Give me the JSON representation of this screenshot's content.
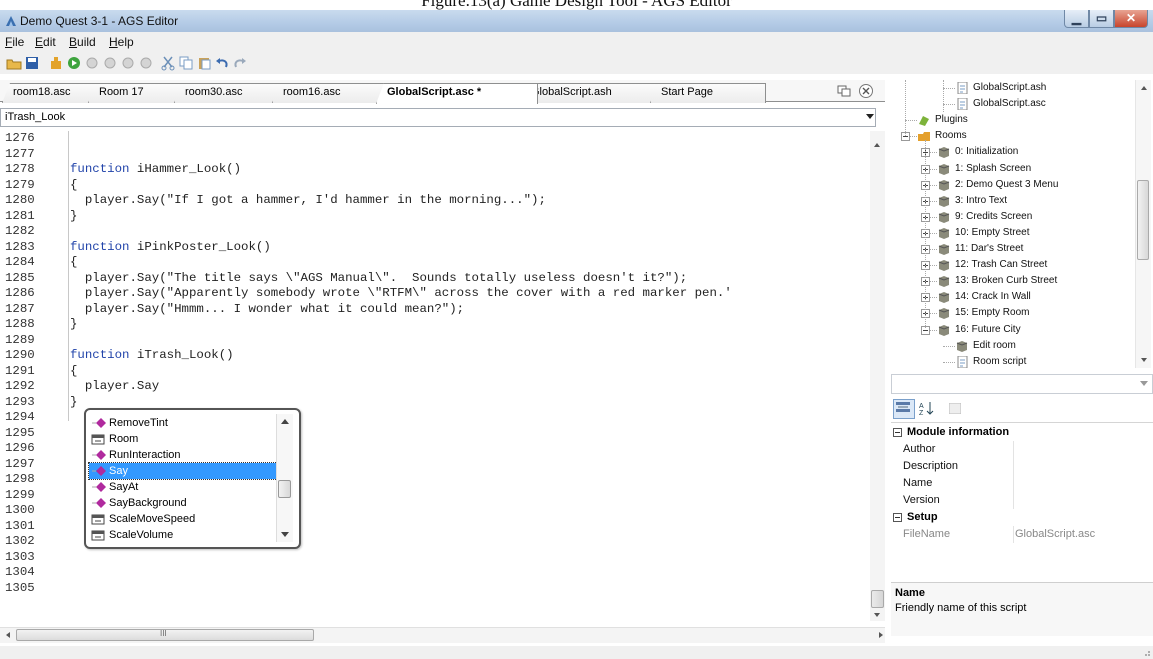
{
  "caption": "Figure.13(a) Game Design Tool - AGS Editor",
  "window": {
    "title": "Demo Quest 3-1 - AGS Editor"
  },
  "menu": [
    {
      "label": "File",
      "mnemonic": "F",
      "rest": "ile"
    },
    {
      "label": "Edit",
      "mnemonic": "E",
      "rest": "dit"
    },
    {
      "label": "Build",
      "mnemonic": "B",
      "rest": "uild"
    },
    {
      "label": "Help",
      "mnemonic": "H",
      "rest": "elp"
    }
  ],
  "tabs": [
    {
      "label": "room18.asc",
      "active": false
    },
    {
      "label": "Room 17",
      "active": false
    },
    {
      "label": "room30.asc",
      "active": false
    },
    {
      "label": "room16.asc",
      "active": false
    },
    {
      "label": "GlobalScript.asc *",
      "active": true
    },
    {
      "label": "GlobalScript.ash",
      "active": false
    },
    {
      "label": "Start Page",
      "active": false
    }
  ],
  "function_dropdown": {
    "value": "iTrash_Look"
  },
  "code_lines": [
    {
      "n": "1276",
      "text": ""
    },
    {
      "n": "1277",
      "text": ""
    },
    {
      "n": "1278",
      "text": "function iHammer_Look()"
    },
    {
      "n": "1279",
      "text": "{"
    },
    {
      "n": "1280",
      "text": "  player.Say(\"If I got a hammer, I'd hammer in the morning...\");"
    },
    {
      "n": "1281",
      "text": "}"
    },
    {
      "n": "1282",
      "text": ""
    },
    {
      "n": "1283",
      "text": "function iPinkPoster_Look()"
    },
    {
      "n": "1284",
      "text": "{"
    },
    {
      "n": "1285",
      "text": "  player.Say(\"The title says \\\"AGS Manual\\\".  Sounds totally useless doesn't it?\");"
    },
    {
      "n": "1286",
      "text": "  player.Say(\"Apparently somebody wrote \\\"RTFM\\\" across the cover with a red marker pen.'"
    },
    {
      "n": "1287",
      "text": "  player.Say(\"Hmmm... I wonder what it could mean?\");"
    },
    {
      "n": "1288",
      "text": "}"
    },
    {
      "n": "1289",
      "text": ""
    },
    {
      "n": "1290",
      "text": "function iTrash_Look()"
    },
    {
      "n": "1291",
      "text": "{"
    },
    {
      "n": "1292",
      "text": "  player.Say"
    },
    {
      "n": "1293",
      "text": "}"
    },
    {
      "n": "1294",
      "text": ""
    },
    {
      "n": "1295",
      "text": ""
    },
    {
      "n": "1296",
      "text": ""
    },
    {
      "n": "1297",
      "text": ""
    },
    {
      "n": "1298",
      "text": ""
    },
    {
      "n": "1299",
      "text": ""
    },
    {
      "n": "1300",
      "text": ""
    },
    {
      "n": "1301",
      "text": ""
    },
    {
      "n": "1302",
      "text": ""
    },
    {
      "n": "1303",
      "text": ""
    },
    {
      "n": "1304",
      "text": ""
    },
    {
      "n": "1305",
      "text": ""
    }
  ],
  "autocomplete": {
    "items": [
      {
        "label": "RemoveTint",
        "icon": "method-icon",
        "selected": false
      },
      {
        "label": "Room",
        "icon": "property-icon",
        "selected": false
      },
      {
        "label": "RunInteraction",
        "icon": "method-icon",
        "selected": false
      },
      {
        "label": "Say",
        "icon": "method-icon",
        "selected": true
      },
      {
        "label": "SayAt",
        "icon": "method-icon",
        "selected": false
      },
      {
        "label": "SayBackground",
        "icon": "method-icon",
        "selected": false
      },
      {
        "label": "ScaleMoveSpeed",
        "icon": "property-icon",
        "selected": false
      },
      {
        "label": "ScaleVolume",
        "icon": "property-icon",
        "selected": false
      }
    ]
  },
  "tree": [
    {
      "label": "GlobalScript.ash",
      "icon": "script-file-icon",
      "indent": 3
    },
    {
      "label": "GlobalScript.asc",
      "icon": "script-file-icon",
      "indent": 3
    },
    {
      "label": "Plugins",
      "icon": "plugin-icon",
      "indent": 1
    },
    {
      "label": "Rooms",
      "icon": "rooms-folder-icon",
      "indent": 1,
      "expander": "minus"
    },
    {
      "label": "0: Initialization",
      "icon": "room-icon",
      "indent": 2,
      "expander": "plus"
    },
    {
      "label": "1: Splash Screen",
      "icon": "room-icon",
      "indent": 2,
      "expander": "plus"
    },
    {
      "label": "2: Demo Quest 3 Menu",
      "icon": "room-icon",
      "indent": 2,
      "expander": "plus"
    },
    {
      "label": "3: Intro Text",
      "icon": "room-icon",
      "indent": 2,
      "expander": "plus"
    },
    {
      "label": "9: Credits Screen",
      "icon": "room-icon",
      "indent": 2,
      "expander": "plus"
    },
    {
      "label": "10: Empty Street",
      "icon": "room-icon",
      "indent": 2,
      "expander": "plus"
    },
    {
      "label": "11: Dar's Street",
      "icon": "room-icon",
      "indent": 2,
      "expander": "plus"
    },
    {
      "label": "12: Trash Can Street",
      "icon": "room-icon",
      "indent": 2,
      "expander": "plus"
    },
    {
      "label": "13: Broken Curb Street",
      "icon": "room-icon",
      "indent": 2,
      "expander": "plus"
    },
    {
      "label": "14: Crack In Wall",
      "icon": "room-icon",
      "indent": 2,
      "expander": "plus"
    },
    {
      "label": "15: Empty Room",
      "icon": "room-icon",
      "indent": 2,
      "expander": "plus"
    },
    {
      "label": "16: Future City",
      "icon": "room-icon",
      "indent": 2,
      "expander": "minus"
    },
    {
      "label": "Edit room",
      "icon": "room-icon",
      "indent": 3
    },
    {
      "label": "Room script",
      "icon": "script-file-icon",
      "indent": 3
    }
  ],
  "properties": {
    "groups": [
      {
        "title": "Module information",
        "rows": [
          {
            "key": "Author",
            "value": ""
          },
          {
            "key": "Description",
            "value": ""
          },
          {
            "key": "Name",
            "value": ""
          },
          {
            "key": "Version",
            "value": ""
          }
        ]
      },
      {
        "title": "Setup",
        "rows": [
          {
            "key": "FileName",
            "value": "GlobalScript.asc"
          }
        ]
      }
    ],
    "help_title": "Name",
    "help_desc": "Friendly name of this script"
  },
  "colors": {
    "keyword": "#2244aa",
    "selection": "#3399ff",
    "titlebar": "#b4cbe6"
  }
}
